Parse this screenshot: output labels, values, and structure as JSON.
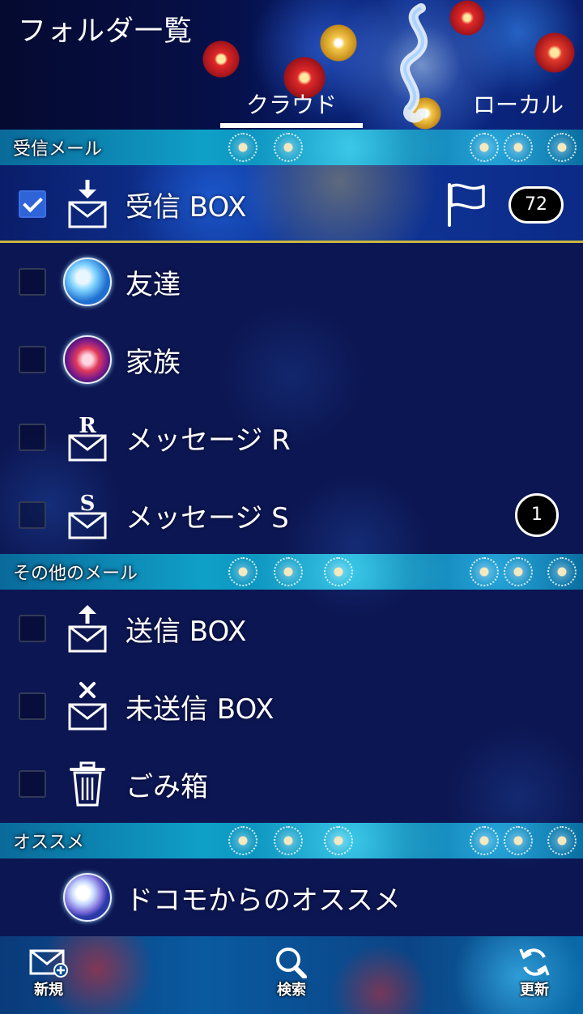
{
  "header": {
    "title": "フォルダ一覧",
    "tabs": [
      {
        "label": "クラウド",
        "active": true
      },
      {
        "label": "ローカル",
        "active": false
      }
    ]
  },
  "sections": [
    {
      "label": "受信メール",
      "folders": [
        {
          "label": "受信 BOX",
          "icon": "inbox-download-icon",
          "checked": true,
          "flag": true,
          "count": "72"
        },
        {
          "label": "友達",
          "icon": "dragon-avatar-icon",
          "checked": false
        },
        {
          "label": "家族",
          "icon": "flower-avatar-icon",
          "checked": false
        },
        {
          "label": "メッセージ R",
          "icon": "message-r-icon",
          "checked": false
        },
        {
          "label": "メッセージ S",
          "icon": "message-s-icon",
          "checked": false,
          "count": "1"
        }
      ]
    },
    {
      "label": "その他のメール",
      "folders": [
        {
          "label": "送信 BOX",
          "icon": "outbox-upload-icon",
          "checked": false
        },
        {
          "label": "未送信 BOX",
          "icon": "unsent-x-icon",
          "checked": false
        },
        {
          "label": "ごみ箱",
          "icon": "trash-icon",
          "checked": false
        }
      ]
    },
    {
      "label": "オススメ",
      "folders": [
        {
          "label": "ドコモからのオススメ",
          "icon": "dragon-avatar-icon"
        }
      ]
    }
  ],
  "bottom_bar": {
    "new_label": "新規",
    "search_label": "検索",
    "refresh_label": "更新"
  },
  "colors": {
    "accent_check": "#2f63d8",
    "selected_border": "#c9b640",
    "section_band": "#0fa0c8"
  }
}
